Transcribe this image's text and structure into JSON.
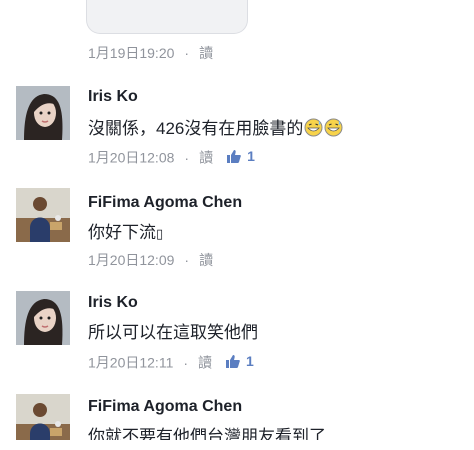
{
  "top_meta": {
    "time": "1月19日19:20",
    "sep": "·",
    "read": "讀"
  },
  "comments": [
    {
      "name": "Iris Ko",
      "text": "沒關係，426沒有在用臉書的",
      "time": "1月20日12:08",
      "sep": "·",
      "read": "讀",
      "likes": "1",
      "emojis": [
        "grinning-sweat-icon",
        "grinning-sweat-icon"
      ]
    },
    {
      "name": "FiFima Agoma Chen",
      "text": "你好下流",
      "text_tail": "▯",
      "time": "1月20日12:09",
      "sep": "·",
      "read": "讀"
    },
    {
      "name": "Iris Ko",
      "text": "所以可以在這取笑他們",
      "time": "1月20日12:11",
      "sep": "·",
      "read": "讀",
      "likes": "1"
    },
    {
      "name": "FiFima Agoma Chen",
      "text": "你就不要有他們台灣朋友看到了"
    }
  ],
  "colors": {
    "meta": "#90949c",
    "like": "#5b7ec1",
    "name": "#1d2129"
  }
}
